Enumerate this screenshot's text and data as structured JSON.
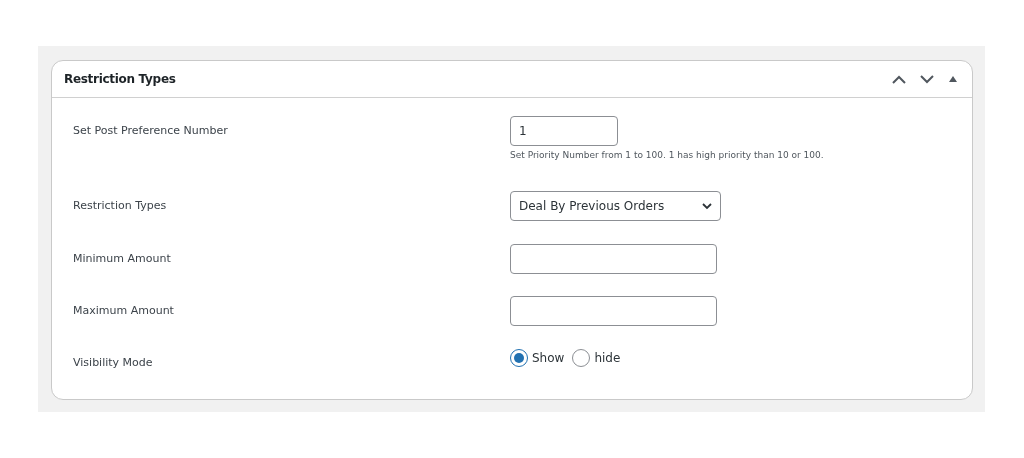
{
  "panel": {
    "title": "Restriction Types",
    "expanded": true
  },
  "fields": [
    {
      "kind": "text",
      "label": "Set Post Preference Number",
      "value": "1",
      "help": "Set Priority Number from 1 to 100. 1 has high priority than 10 or 100."
    },
    {
      "kind": "select",
      "label": "Restriction Types",
      "value": "Deal By Previous Orders"
    },
    {
      "kind": "text",
      "label": "Minimum Amount"
    },
    {
      "kind": "text",
      "label": "Maximum Amount"
    },
    {
      "kind": "radio",
      "label": "Visibility Mode",
      "options": [
        {
          "label": "Show",
          "selected": true
        },
        {
          "label": "hide",
          "selected": false
        }
      ]
    }
  ]
}
